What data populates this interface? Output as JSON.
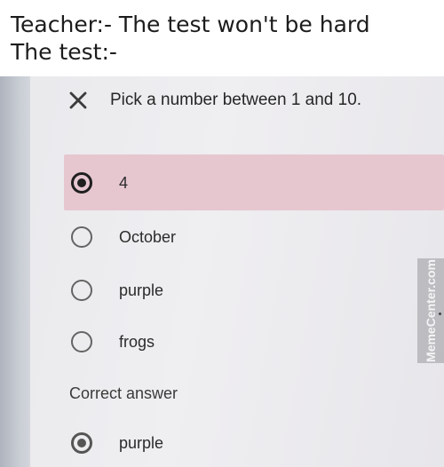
{
  "caption": {
    "line1": "Teacher:- The test won't be hard",
    "line2": "The test:-"
  },
  "quiz": {
    "question": "Pick a number between 1 and 10.",
    "result_icon": "close-icon",
    "options": [
      {
        "label": "4",
        "selected": true
      },
      {
        "label": "October",
        "selected": false
      },
      {
        "label": "purple",
        "selected": false
      },
      {
        "label": "frogs",
        "selected": false
      }
    ],
    "correct_header": "Correct answer",
    "correct_answer": "purple"
  },
  "watermark": "MemeCenter.com",
  "colors": {
    "selected_band": "#e6c7d0",
    "text": "#262626"
  }
}
